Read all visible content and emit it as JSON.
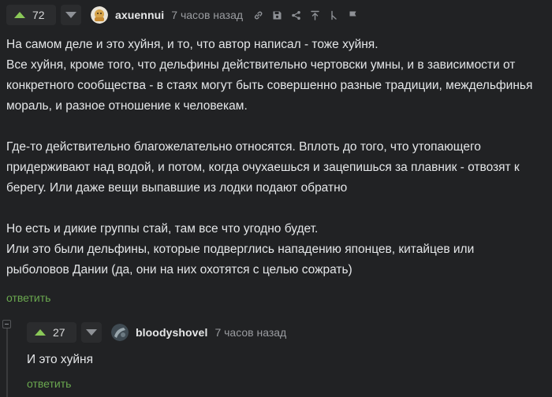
{
  "comment": {
    "votes": "72",
    "username": "axuennui",
    "time": "7 часов назад",
    "paragraphs": [
      "На самом деле и это хуйня, и то, что автор написал - тоже хуйня.\nВсе хуйня, кроме того, что дельфины действительно чертовски умны, и в зависимости от\nконкретного сообщества - в стаях могут быть совершенно разные традиции, междельфинья\nмораль, и разное отношение к человекам.",
      "Где-то действительно благожелательно относятся. Вплоть до того, что утопающего\nпридерживают над водой, и потом, когда очухаешься и зацепишься за плавник - отвозят к\nберегу. Или даже вещи выпавшие из лодки подают обратно",
      "Но есть и дикие группы стай, там все что угодно будет.\nИли это были дельфины, которые подверглись нападению японцев, китайцев или\nрыболовов Дании (да, они на них охотятся с целью сожрать)"
    ],
    "reply_label": "ответить"
  },
  "reply": {
    "votes": "27",
    "username": "bloodyshovel",
    "time": "7 часов назад",
    "text": "И это хуйня",
    "reply_label": "ответить"
  },
  "colors": {
    "background": "#212224",
    "upvote": "#8ac858",
    "reply_link": "#6aa84f"
  },
  "icons": [
    "link-icon",
    "save-icon",
    "share-icon",
    "jump-to-parent-icon",
    "branch-icon",
    "report-flag-icon"
  ]
}
